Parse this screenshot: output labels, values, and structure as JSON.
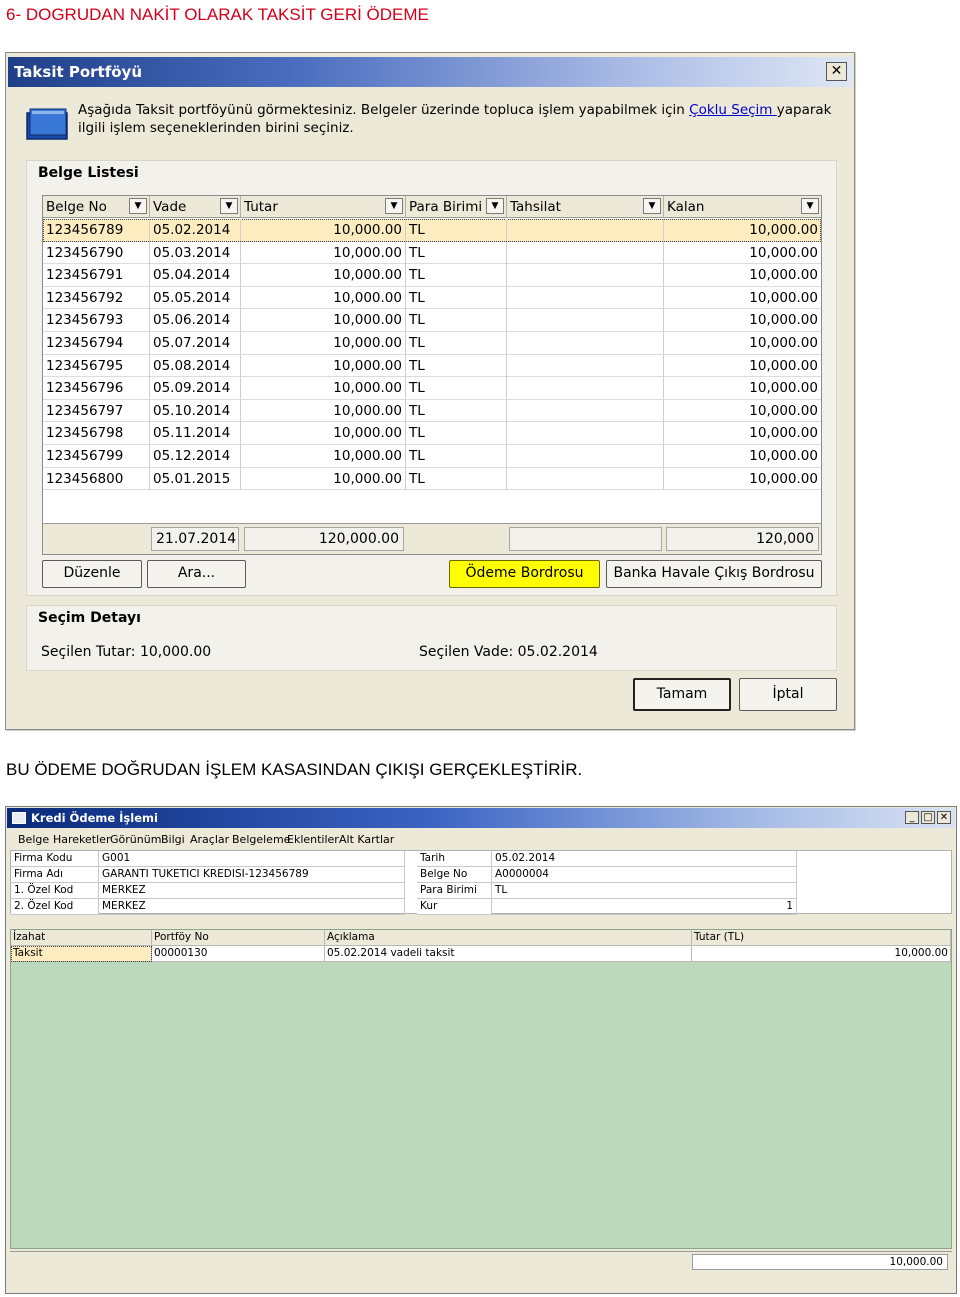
{
  "heading1": "6- DOGRUDAN NAKİT OLARAK TAKSİT GERİ ÖDEME",
  "heading2": "BU ÖDEME DOĞRUDAN İŞLEM KASASINDAN ÇIKIŞI GERÇEKLEŞTİRİR.",
  "portfolio_dialog": {
    "title": "Taksit Portföyü",
    "close_label": "✕",
    "info_before_link": "Aşağıda Taksit portföyünü görmektesiniz. Belgeler üzerinde topluca işlem yapabilmek için ",
    "info_link": "Çoklu Seçim ",
    "info_after_link": "yaparak ilgili işlem seçeneklerinden birini seçiniz.",
    "list_title": "Belge Listesi",
    "columns": [
      "Belge No",
      "Vade",
      "Tutar",
      "Para Birimi",
      "Tahsilat",
      "Kalan"
    ],
    "rows": [
      [
        "123456789",
        "05.02.2014",
        "10,000.00",
        "TL",
        "",
        "10,000.00"
      ],
      [
        "123456790",
        "05.03.2014",
        "10,000.00",
        "TL",
        "",
        "10,000.00"
      ],
      [
        "123456791",
        "05.04.2014",
        "10,000.00",
        "TL",
        "",
        "10,000.00"
      ],
      [
        "123456792",
        "05.05.2014",
        "10,000.00",
        "TL",
        "",
        "10,000.00"
      ],
      [
        "123456793",
        "05.06.2014",
        "10,000.00",
        "TL",
        "",
        "10,000.00"
      ],
      [
        "123456794",
        "05.07.2014",
        "10,000.00",
        "TL",
        "",
        "10,000.00"
      ],
      [
        "123456795",
        "05.08.2014",
        "10,000.00",
        "TL",
        "",
        "10,000.00"
      ],
      [
        "123456796",
        "05.09.2014",
        "10,000.00",
        "TL",
        "",
        "10,000.00"
      ],
      [
        "123456797",
        "05.10.2014",
        "10,000.00",
        "TL",
        "",
        "10,000.00"
      ],
      [
        "123456798",
        "05.11.2014",
        "10,000.00",
        "TL",
        "",
        "10,000.00"
      ],
      [
        "123456799",
        "05.12.2014",
        "10,000.00",
        "TL",
        "",
        "10,000.00"
      ],
      [
        "123456800",
        "05.01.2015",
        "10,000.00",
        "TL",
        "",
        "10,000.00"
      ]
    ],
    "footer": {
      "vade_total": "21.07.2014",
      "tutar_total": "120,000.00",
      "tahsilat_total": "",
      "kalan_total": "120,000"
    },
    "buttons": {
      "duzenle": "Düzenle",
      "ara": "Ara...",
      "odeme_bordrosu": "Ödeme Bordrosu",
      "banka_havale": "Banka Havale Çıkış Bordrosu",
      "tamam": "Tamam",
      "iptal": "İptal"
    },
    "detail_title": "Seçim Detayı",
    "selected_amount": "Seçilen Tutar: 10,000.00",
    "selected_date": "Seçilen Vade: 05.02.2014"
  },
  "credit_dialog": {
    "title": "Kredi Ödeme İşlemi",
    "menu": [
      "Belge",
      "Hareketler",
      "Görünüm",
      "Bilgi",
      "Araçlar",
      "Belgeleme",
      "Eklentiler",
      "Alt Kartlar"
    ],
    "form_left": [
      {
        "label": "Firma Kodu",
        "value": "G001"
      },
      {
        "label": "Firma Adı",
        "value": "GARANTI TUKETICI KREDISI-123456789"
      },
      {
        "label": "1. Özel Kod",
        "value": "MERKEZ"
      },
      {
        "label": "2. Özel Kod",
        "value": "MERKEZ"
      }
    ],
    "form_right": [
      {
        "label": "Tarih",
        "value": "05.02.2014"
      },
      {
        "label": "Belge No",
        "value": "A0000004"
      },
      {
        "label": "Para Birimi",
        "value": "TL"
      },
      {
        "label": "Kur",
        "value": "1"
      }
    ],
    "columns": [
      "İzahat",
      "Portföy No",
      "Açıklama",
      "Tutar (TL)"
    ],
    "row": [
      "Taksit",
      "00000130",
      "05.02.2014 vadeli taksit",
      "10,000.00"
    ],
    "total": "10,000.00"
  }
}
